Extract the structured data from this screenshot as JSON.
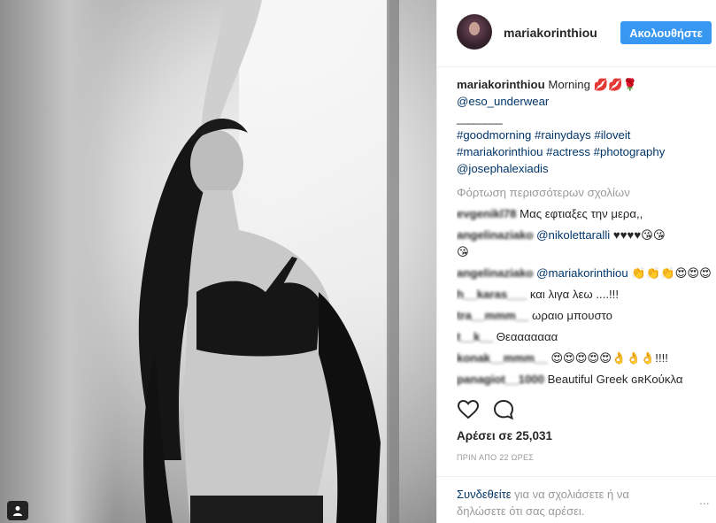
{
  "post": {
    "username": "mariakorinthiou",
    "follow_label": "Ακολουθήστε",
    "caption_user": "mariakorinthiou",
    "caption_text": "Morning",
    "caption_emoji": "💋💋🌹",
    "mention": "@eso_underwear",
    "separator": "________",
    "hashtags_line1": "#goodmorning #rainydays #iloveit",
    "hashtags_line2": "#mariakorinthiou #actress #photography",
    "mention2": "@josephalexiadis",
    "load_more": "Φόρτωση περισσότερων σχολίων"
  },
  "comments": [
    {
      "user": "evgenikl78",
      "text": "Μας εφτιαξες την μερα,,"
    },
    {
      "user": "angelinaziako",
      "mention": "@nikolettaralli",
      "text": "♥♥♥♥😘😘",
      "text2": "😘"
    },
    {
      "user": "angelinaziako",
      "mention": "@mariakorinthiou",
      "text": "👏👏👏😍😍😍"
    },
    {
      "user": "h__karas___",
      "text": "και λιγα λεω ....!!!"
    },
    {
      "user": "tra__mmm__",
      "text": "ωραιο μπουστο"
    },
    {
      "user": "t__k__",
      "text": "Θεααααααα"
    },
    {
      "user": "konak__mmm__",
      "text": "😍😍😍😍😍👌👌👌!!!!"
    },
    {
      "user": "panagiot__1000",
      "text": "Beautiful Greek ɢʀΚούκλα"
    }
  ],
  "actions": {
    "like_icon": "heart-icon",
    "comment_icon": "comment-icon",
    "likes_text": "Αρέσει σε 25,031",
    "timestamp": "ΠΡΙΝ ΑΠΟ 22 ΩΡΕΣ"
  },
  "footer": {
    "login_link": "Συνδεθείτε",
    "login_text": "για να σχολιάσετε ή να δηλώσετε ότι σας αρέσει.",
    "more_label": "..."
  }
}
